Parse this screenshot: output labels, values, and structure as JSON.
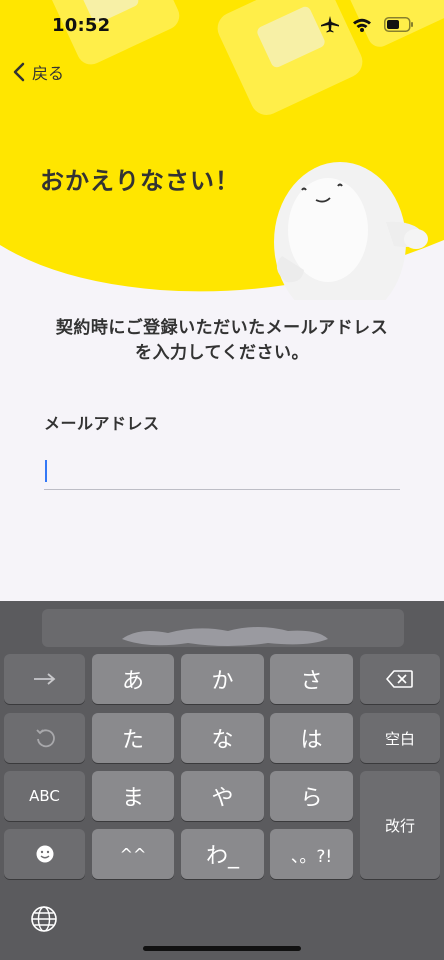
{
  "status_bar": {
    "time": "10:52"
  },
  "nav": {
    "back_label": "戻る"
  },
  "hero": {
    "title": "おかえりなさい！"
  },
  "form": {
    "instruction_line1": "契約時にご登録いただいたメールアドレス",
    "instruction_line2": "を入力してください。",
    "email_label": "メールアドレス",
    "email_value": ""
  },
  "keyboard": {
    "layout": "Japanese kana flick",
    "row1": [
      "→",
      "あ",
      "か",
      "さ",
      "⌫"
    ],
    "row2": [
      "↺",
      "た",
      "な",
      "は",
      "空白"
    ],
    "row3": [
      "ABC",
      "ま",
      "や",
      "ら"
    ],
    "row4": [
      "☻",
      "^^",
      "わ_",
      "、。?!"
    ],
    "enter_label": "改行",
    "icons": {
      "globe": "globe-icon",
      "delete": "backspace-icon",
      "undo": "undo-icon",
      "next": "arrow-right-icon",
      "emoji": "emoji-icon"
    }
  },
  "colors": {
    "accent_yellow": "#ffe600",
    "keyboard_bg": "#5b5b5e",
    "key_main": "#8a8a8d",
    "key_side": "#6d6d70"
  }
}
